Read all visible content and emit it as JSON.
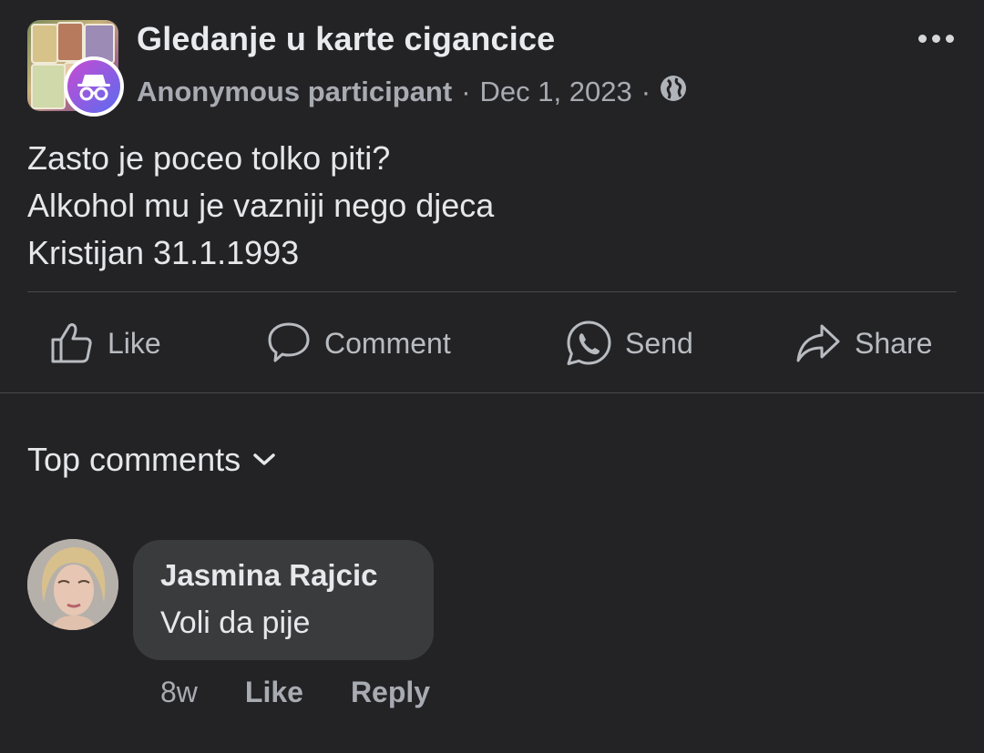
{
  "post": {
    "group_name": "Gledanje u karte cigancice",
    "author": "Anonymous participant",
    "dot": "·",
    "date": "Dec 1, 2023",
    "privacy_icon": "globe-icon",
    "body_lines": [
      "Zasto je poceo tolko piti?",
      "Alkohol mu je vazniji nego djeca",
      "Kristijan 31.1.1993"
    ]
  },
  "actions": {
    "like": "Like",
    "comment": "Comment",
    "send": "Send",
    "share": "Share"
  },
  "comments_section": {
    "sort_label": "Top comments",
    "comments": [
      {
        "name": "Jasmina Rajcic",
        "text": "Voli da pije",
        "time": "8w",
        "like": "Like",
        "reply": "Reply"
      }
    ]
  },
  "colors": {
    "background": "#232326",
    "bubble": "#3a3b3d",
    "anon_gradient": [
      "#c74bd1",
      "#5a6cf0"
    ]
  }
}
